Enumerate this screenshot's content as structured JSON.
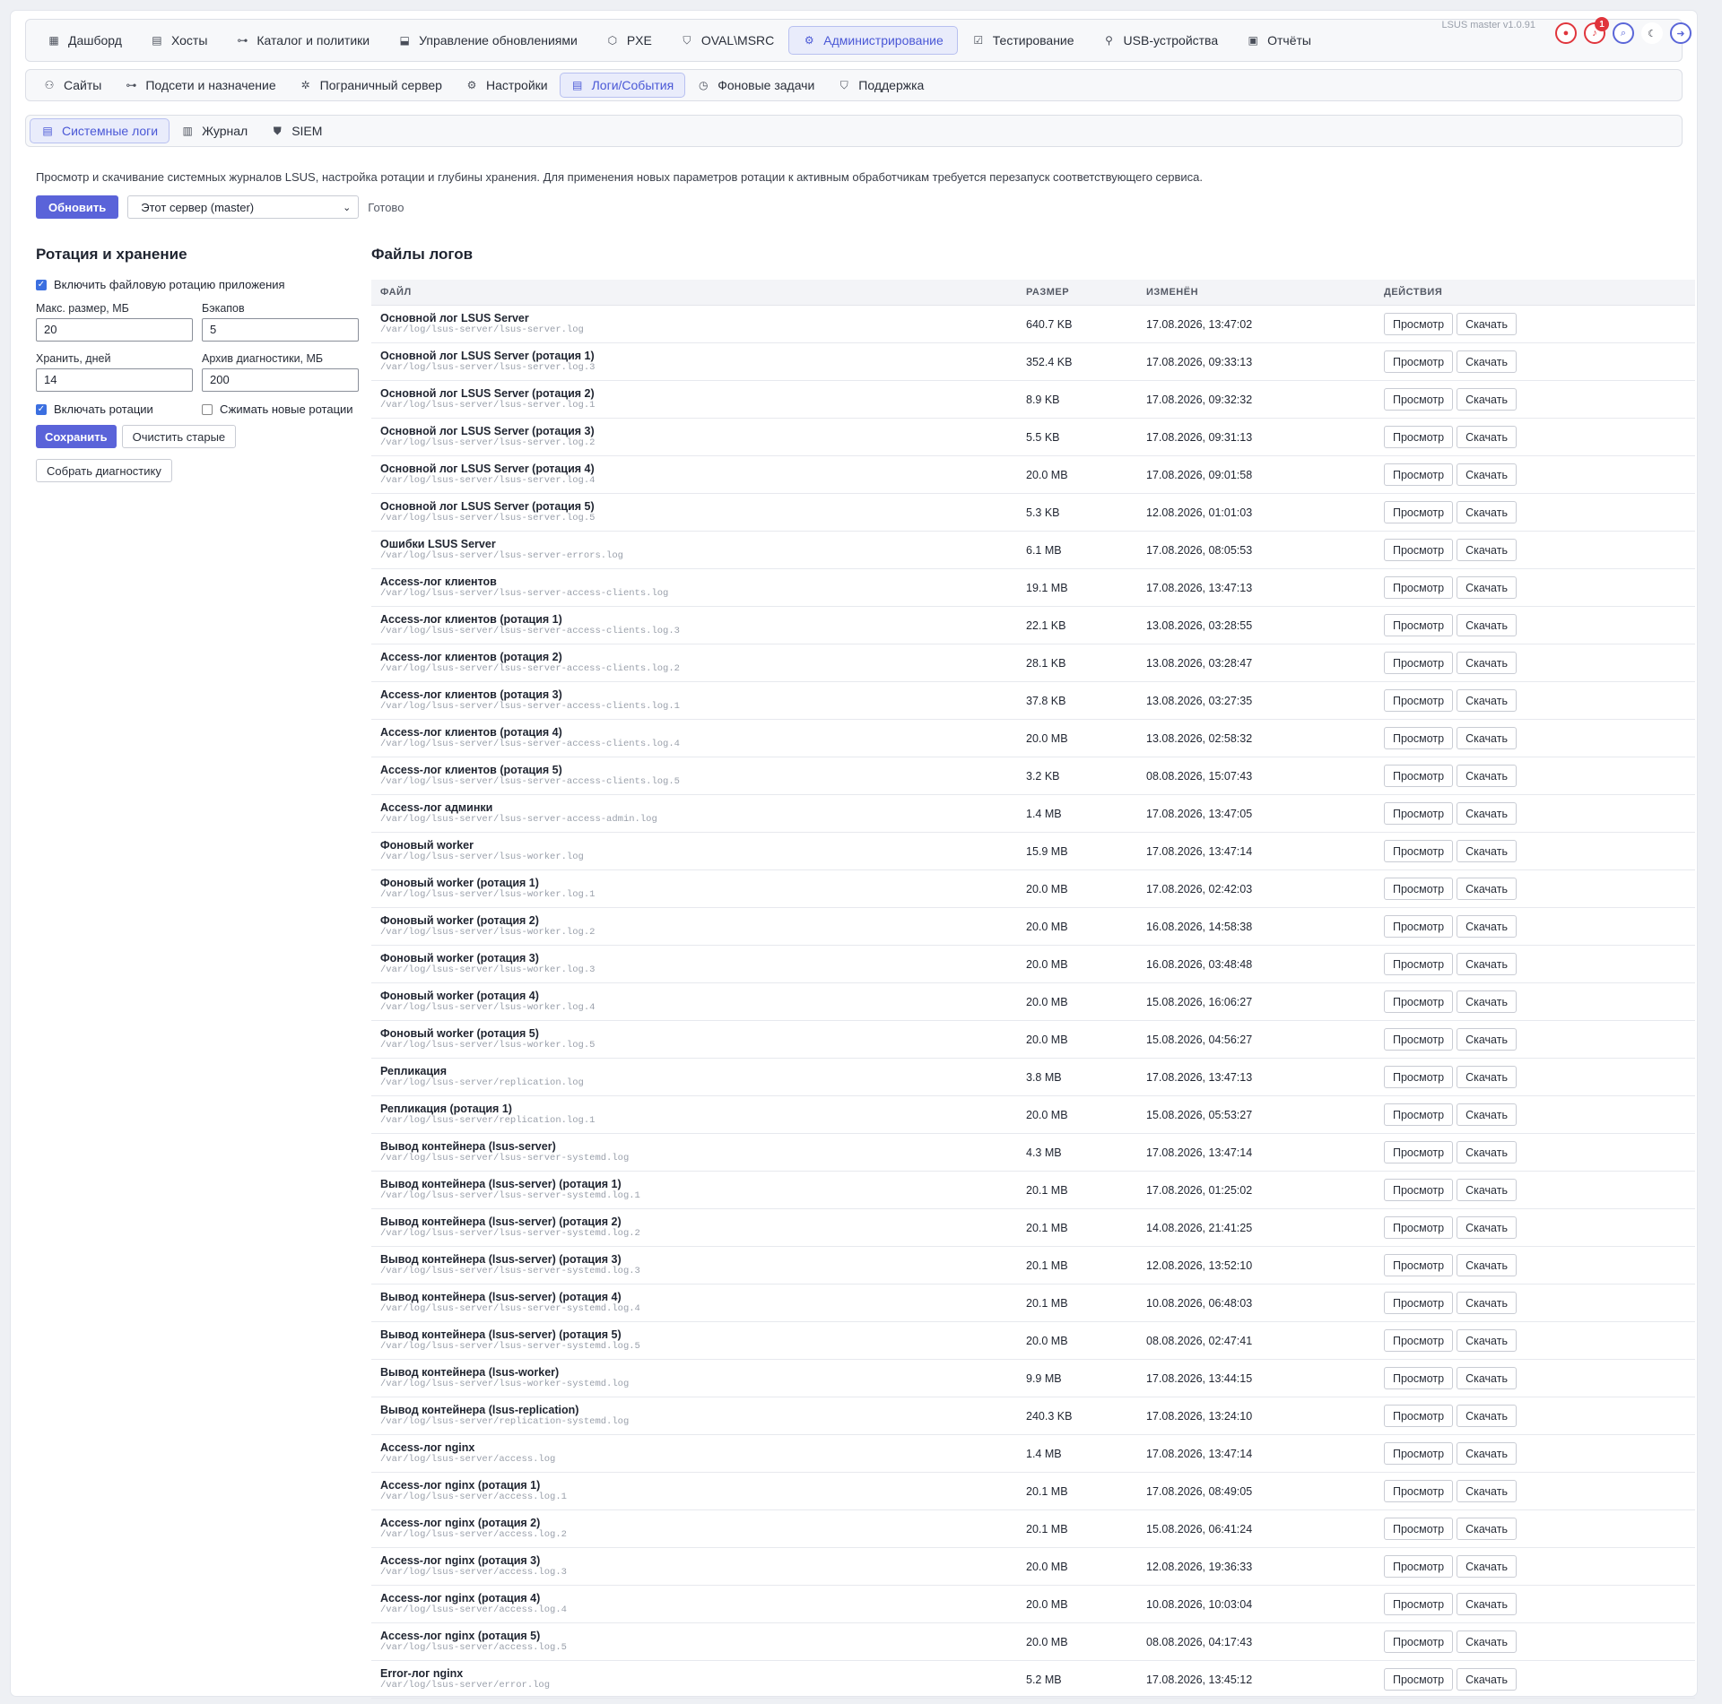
{
  "nav": {
    "tabs": [
      {
        "label": "Дашборд",
        "icon": "dashboard-icon",
        "glyph": "▦"
      },
      {
        "label": "Хосты",
        "icon": "server-icon",
        "glyph": "▤"
      },
      {
        "label": "Каталог и политики",
        "icon": "tree-icon",
        "glyph": "⊶"
      },
      {
        "label": "Управление обновлениями",
        "icon": "update-icon",
        "glyph": "⬓"
      },
      {
        "label": "PXE",
        "icon": "cube-icon",
        "glyph": "⬡"
      },
      {
        "label": "OVAL\\MSRC",
        "icon": "shield-icon",
        "glyph": "⛉"
      },
      {
        "label": "Администрирование",
        "icon": "admin-icon",
        "glyph": "⚙"
      },
      {
        "label": "Тестирование",
        "icon": "test-icon",
        "glyph": "☑"
      },
      {
        "label": "USB-устройства",
        "icon": "usb-icon",
        "glyph": "⚲"
      },
      {
        "label": "Отчёты",
        "icon": "report-icon",
        "glyph": "▣"
      }
    ],
    "version": "LSUS master v1.0.91",
    "notification_count": "1"
  },
  "subnav": {
    "tabs": [
      {
        "label": "Сайты",
        "icon": "sites-icon",
        "glyph": "⚇"
      },
      {
        "label": "Подсети и назначение",
        "icon": "subnet-icon",
        "glyph": "⊶"
      },
      {
        "label": "Пограничный сервер",
        "icon": "edge-icon",
        "glyph": "✲"
      },
      {
        "label": "Настройки",
        "icon": "settings-icon",
        "glyph": "⚙"
      },
      {
        "label": "Логи/События",
        "icon": "logs-icon",
        "glyph": "▤"
      },
      {
        "label": "Фоновые задачи",
        "icon": "clock-icon",
        "glyph": "◷"
      },
      {
        "label": "Поддержка",
        "icon": "support-icon",
        "glyph": "⛉"
      }
    ]
  },
  "logtabs": {
    "tabs": [
      {
        "label": "Системные логи",
        "icon": "syslog-icon",
        "glyph": "▤"
      },
      {
        "label": "Журнал",
        "icon": "journal-icon",
        "glyph": "▥"
      },
      {
        "label": "SIEM",
        "icon": "siem-icon",
        "glyph": "⛊"
      }
    ]
  },
  "description": "Просмотр и скачивание системных журналов LSUS, настройка ротации и глубины хранения. Для применения новых параметров ротации к активным обработчикам требуется перезапуск соответствующего сервиса.",
  "toolbar": {
    "refresh_label": "Обновить",
    "server_select": "Этот сервер (master)",
    "status": "Готово"
  },
  "rotation": {
    "title": "Ротация и хранение",
    "enable_label": "Включить файловую ротацию приложения",
    "max_size_label": "Макс. размер, МБ",
    "max_size_value": "20",
    "backups_label": "Бэкапов",
    "backups_value": "5",
    "keep_days_label": "Хранить, дней",
    "keep_days_value": "14",
    "archive_label": "Архив диагностики, МБ",
    "archive_value": "200",
    "include_label": "Включать ротации",
    "compress_label": "Сжимать новые ротации",
    "save_label": "Сохранить",
    "clean_label": "Очистить старые",
    "collect_label": "Собрать диагностику"
  },
  "logs": {
    "title": "Файлы логов",
    "columns": {
      "file": "ФАЙЛ",
      "size": "РАЗМЕР",
      "modified": "ИЗМЕНЁН",
      "actions": "ДЕЙСТВИЯ"
    },
    "view_label": "Просмотр",
    "download_label": "Скачать",
    "rows": [
      {
        "name": "Основной лог LSUS Server",
        "path": "/var/log/lsus-server/lsus-server.log",
        "size": "640.7 KB",
        "modified": "17.08.2026, 13:47:02"
      },
      {
        "name": "Основной лог LSUS Server (ротация 1)",
        "path": "/var/log/lsus-server/lsus-server.log.3",
        "size": "352.4 KB",
        "modified": "17.08.2026, 09:33:13"
      },
      {
        "name": "Основной лог LSUS Server (ротация 2)",
        "path": "/var/log/lsus-server/lsus-server.log.1",
        "size": "8.9 KB",
        "modified": "17.08.2026, 09:32:32"
      },
      {
        "name": "Основной лог LSUS Server (ротация 3)",
        "path": "/var/log/lsus-server/lsus-server.log.2",
        "size": "5.5 KB",
        "modified": "17.08.2026, 09:31:13"
      },
      {
        "name": "Основной лог LSUS Server (ротация 4)",
        "path": "/var/log/lsus-server/lsus-server.log.4",
        "size": "20.0 MB",
        "modified": "17.08.2026, 09:01:58"
      },
      {
        "name": "Основной лог LSUS Server (ротация 5)",
        "path": "/var/log/lsus-server/lsus-server.log.5",
        "size": "5.3 KB",
        "modified": "12.08.2026, 01:01:03"
      },
      {
        "name": "Ошибки LSUS Server",
        "path": "/var/log/lsus-server/lsus-server-errors.log",
        "size": "6.1 MB",
        "modified": "17.08.2026, 08:05:53"
      },
      {
        "name": "Access-лог клиентов",
        "path": "/var/log/lsus-server/lsus-server-access-clients.log",
        "size": "19.1 MB",
        "modified": "17.08.2026, 13:47:13"
      },
      {
        "name": "Access-лог клиентов (ротация 1)",
        "path": "/var/log/lsus-server/lsus-server-access-clients.log.3",
        "size": "22.1 KB",
        "modified": "13.08.2026, 03:28:55"
      },
      {
        "name": "Access-лог клиентов (ротация 2)",
        "path": "/var/log/lsus-server/lsus-server-access-clients.log.2",
        "size": "28.1 KB",
        "modified": "13.08.2026, 03:28:47"
      },
      {
        "name": "Access-лог клиентов (ротация 3)",
        "path": "/var/log/lsus-server/lsus-server-access-clients.log.1",
        "size": "37.8 KB",
        "modified": "13.08.2026, 03:27:35"
      },
      {
        "name": "Access-лог клиентов (ротация 4)",
        "path": "/var/log/lsus-server/lsus-server-access-clients.log.4",
        "size": "20.0 MB",
        "modified": "13.08.2026, 02:58:32"
      },
      {
        "name": "Access-лог клиентов (ротация 5)",
        "path": "/var/log/lsus-server/lsus-server-access-clients.log.5",
        "size": "3.2 KB",
        "modified": "08.08.2026, 15:07:43"
      },
      {
        "name": "Access-лог админки",
        "path": "/var/log/lsus-server/lsus-server-access-admin.log",
        "size": "1.4 MB",
        "modified": "17.08.2026, 13:47:05"
      },
      {
        "name": "Фоновый worker",
        "path": "/var/log/lsus-server/lsus-worker.log",
        "size": "15.9 MB",
        "modified": "17.08.2026, 13:47:14"
      },
      {
        "name": "Фоновый worker (ротация 1)",
        "path": "/var/log/lsus-server/lsus-worker.log.1",
        "size": "20.0 MB",
        "modified": "17.08.2026, 02:42:03"
      },
      {
        "name": "Фоновый worker (ротация 2)",
        "path": "/var/log/lsus-server/lsus-worker.log.2",
        "size": "20.0 MB",
        "modified": "16.08.2026, 14:58:38"
      },
      {
        "name": "Фоновый worker (ротация 3)",
        "path": "/var/log/lsus-server/lsus-worker.log.3",
        "size": "20.0 MB",
        "modified": "16.08.2026, 03:48:48"
      },
      {
        "name": "Фоновый worker (ротация 4)",
        "path": "/var/log/lsus-server/lsus-worker.log.4",
        "size": "20.0 MB",
        "modified": "15.08.2026, 16:06:27"
      },
      {
        "name": "Фоновый worker (ротация 5)",
        "path": "/var/log/lsus-server/lsus-worker.log.5",
        "size": "20.0 MB",
        "modified": "15.08.2026, 04:56:27"
      },
      {
        "name": "Репликация",
        "path": "/var/log/lsus-server/replication.log",
        "size": "3.8 MB",
        "modified": "17.08.2026, 13:47:13"
      },
      {
        "name": "Репликация (ротация 1)",
        "path": "/var/log/lsus-server/replication.log.1",
        "size": "20.0 MB",
        "modified": "15.08.2026, 05:53:27"
      },
      {
        "name": "Вывод контейнера (lsus-server)",
        "path": "/var/log/lsus-server/lsus-server-systemd.log",
        "size": "4.3 MB",
        "modified": "17.08.2026, 13:47:14"
      },
      {
        "name": "Вывод контейнера (lsus-server) (ротация 1)",
        "path": "/var/log/lsus-server/lsus-server-systemd.log.1",
        "size": "20.1 MB",
        "modified": "17.08.2026, 01:25:02"
      },
      {
        "name": "Вывод контейнера (lsus-server) (ротация 2)",
        "path": "/var/log/lsus-server/lsus-server-systemd.log.2",
        "size": "20.1 MB",
        "modified": "14.08.2026, 21:41:25"
      },
      {
        "name": "Вывод контейнера (lsus-server) (ротация 3)",
        "path": "/var/log/lsus-server/lsus-server-systemd.log.3",
        "size": "20.1 MB",
        "modified": "12.08.2026, 13:52:10"
      },
      {
        "name": "Вывод контейнера (lsus-server) (ротация 4)",
        "path": "/var/log/lsus-server/lsus-server-systemd.log.4",
        "size": "20.1 MB",
        "modified": "10.08.2026, 06:48:03"
      },
      {
        "name": "Вывод контейнера (lsus-server) (ротация 5)",
        "path": "/var/log/lsus-server/lsus-server-systemd.log.5",
        "size": "20.0 MB",
        "modified": "08.08.2026, 02:47:41"
      },
      {
        "name": "Вывод контейнера (lsus-worker)",
        "path": "/var/log/lsus-server/lsus-worker-systemd.log",
        "size": "9.9 MB",
        "modified": "17.08.2026, 13:44:15"
      },
      {
        "name": "Вывод контейнера (lsus-replication)",
        "path": "/var/log/lsus-server/replication-systemd.log",
        "size": "240.3 KB",
        "modified": "17.08.2026, 13:24:10"
      },
      {
        "name": "Access-лог nginx",
        "path": "/var/log/lsus-server/access.log",
        "size": "1.4 MB",
        "modified": "17.08.2026, 13:47:14"
      },
      {
        "name": "Access-лог nginx (ротация 1)",
        "path": "/var/log/lsus-server/access.log.1",
        "size": "20.1 MB",
        "modified": "17.08.2026, 08:49:05"
      },
      {
        "name": "Access-лог nginx (ротация 2)",
        "path": "/var/log/lsus-server/access.log.2",
        "size": "20.1 MB",
        "modified": "15.08.2026, 06:41:24"
      },
      {
        "name": "Access-лог nginx (ротация 3)",
        "path": "/var/log/lsus-server/access.log.3",
        "size": "20.0 MB",
        "modified": "12.08.2026, 19:36:33"
      },
      {
        "name": "Access-лог nginx (ротация 4)",
        "path": "/var/log/lsus-server/access.log.4",
        "size": "20.0 MB",
        "modified": "10.08.2026, 10:03:04"
      },
      {
        "name": "Access-лог nginx (ротация 5)",
        "path": "/var/log/lsus-server/access.log.5",
        "size": "20.0 MB",
        "modified": "08.08.2026, 04:17:43"
      },
      {
        "name": "Error-лог nginx",
        "path": "/var/log/lsus-server/error.log",
        "size": "5.2 MB",
        "modified": "17.08.2026, 13:45:12"
      }
    ]
  }
}
